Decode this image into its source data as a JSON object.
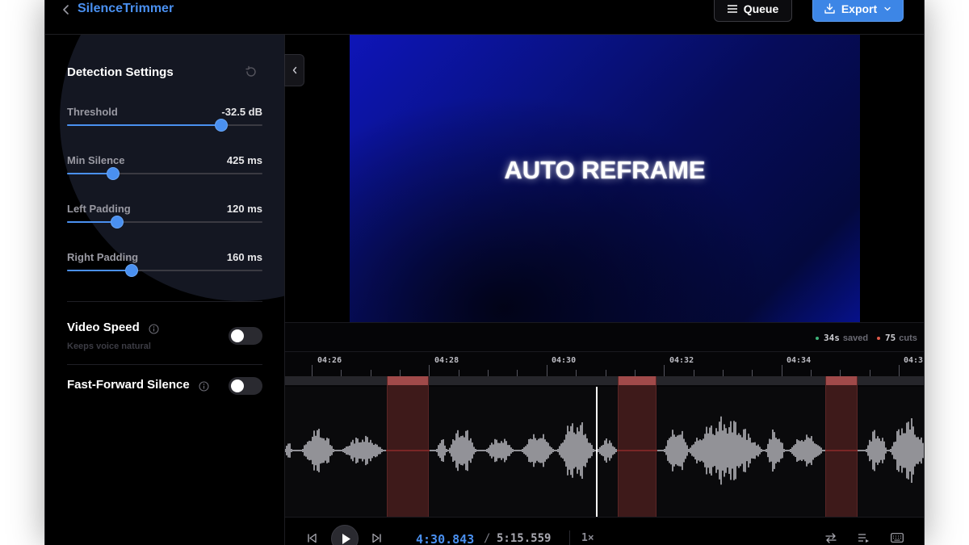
{
  "header": {
    "app_title": "SilenceTrimmer",
    "queue_label": "Queue",
    "export_label": "Export"
  },
  "settings": {
    "title": "Detection Settings",
    "sliders": [
      {
        "label": "Threshold",
        "value": "-32.5 dB",
        "fraction": 0.79
      },
      {
        "label": "Min Silence",
        "value": "425 ms",
        "fraction": 0.235
      },
      {
        "label": "Left Padding",
        "value": "120 ms",
        "fraction": 0.255
      },
      {
        "label": "Right Padding",
        "value": "160 ms",
        "fraction": 0.33
      }
    ],
    "video_speed": {
      "label": "Video Speed",
      "hint": "Keeps voice natural",
      "enabled": false
    },
    "fast_forward": {
      "label": "Fast-Forward Silence",
      "enabled": false
    }
  },
  "preview": {
    "video_text": "AUTO REFRAME"
  },
  "stats": {
    "saved_value": "34s",
    "saved_label": "saved",
    "cuts_value": "75",
    "cuts_label": "cuts",
    "saved_color": "#3fb37a",
    "cuts_color": "#e05a4a"
  },
  "timeline": {
    "ruler_labels": [
      "04:26",
      "04:28",
      "04:30",
      "04:32",
      "04:34",
      "04:3"
    ]
  },
  "transport": {
    "current_time": "4:30.843",
    "separator": "/",
    "total_time": "5:15.559",
    "speed": "1×"
  },
  "colors": {
    "accent": "#4a90f0",
    "cut_region": "#3e1a1a",
    "waveform": "#b4b4bb"
  }
}
